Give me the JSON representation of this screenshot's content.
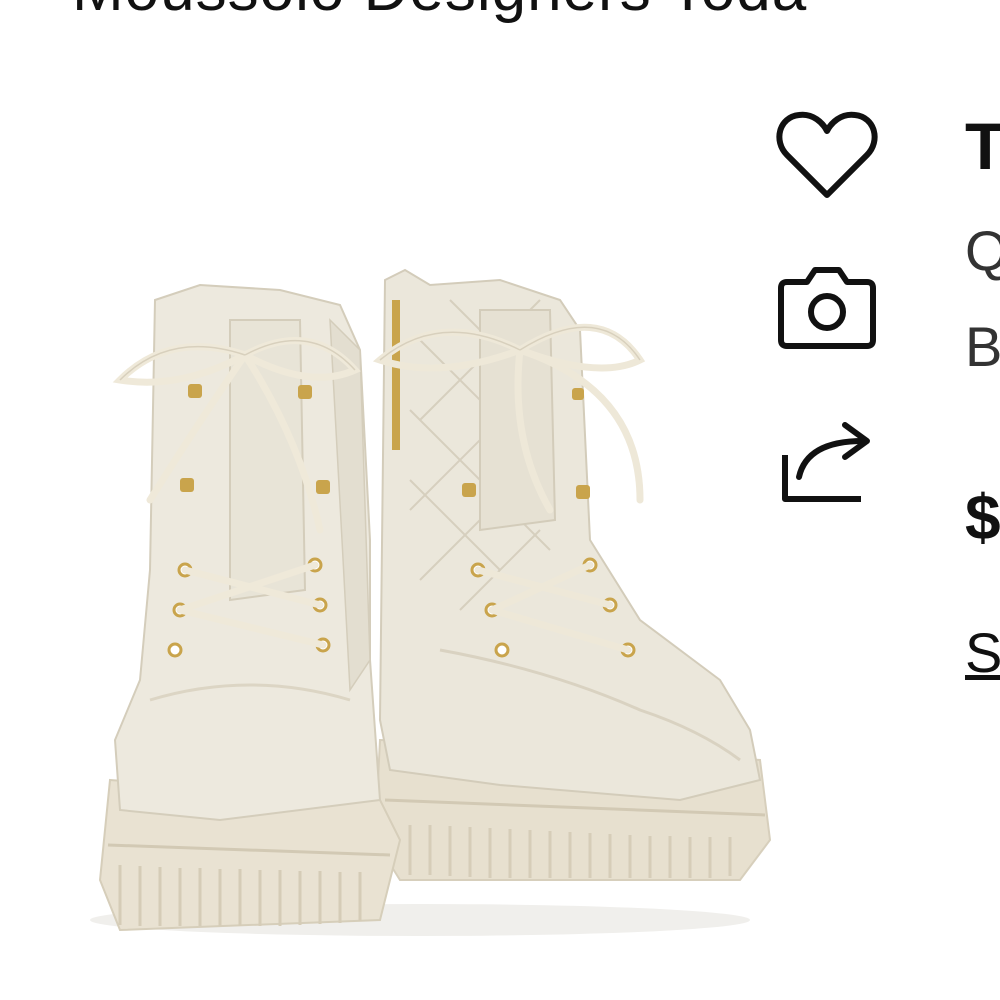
{
  "header": {
    "title": "Moussolo Designers Toda"
  },
  "product": {
    "image_alt": "Quilted leather combat boots",
    "brand_initial": "T",
    "name_line1": "Q",
    "name_line2": "B",
    "price": "$",
    "size_link": "S"
  },
  "actions": {
    "wishlist_icon": "heart-icon",
    "camera_icon": "camera-icon",
    "share_icon": "share-icon"
  },
  "colors": {
    "boot": "#ece8dc",
    "boot_shadow": "#d9d3c3",
    "sole": "#e8e1d1",
    "lace": "#efe9da",
    "hardware": "#c9a44c",
    "icon": "#111111"
  }
}
